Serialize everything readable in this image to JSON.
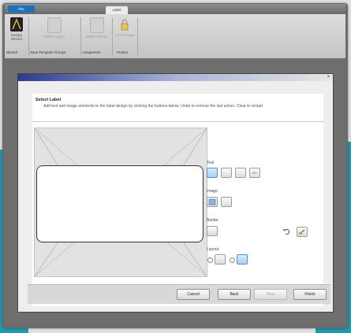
{
  "ribbon_tabs": [
    "File",
    "",
    "",
    "",
    "Label",
    ""
  ],
  "ribbon": {
    "buttons": [
      {
        "label": "Design Wizard",
        "icon": "wizard-icon"
      },
      {
        "label": "Batch Layout",
        "icon": "batch-layout-icon"
      },
      {
        "label": "Match Clause",
        "icon": "match-icon"
      },
      {
        "label": "Lock Groups",
        "icon": "lock-icon"
      }
    ],
    "groups": [
      "Wizard",
      "Save Template Groups",
      "Assignment",
      "Protect"
    ]
  },
  "dialog": {
    "section_title": "Select Label",
    "description": "Add text and image elements to the label design by clicking the buttons below. Undo to remove the last action. Clear to restart.",
    "text_label": "Text",
    "image_label": "Image",
    "border_label": "Border",
    "layout_label": "Layout",
    "text_buttons": [
      "",
      "",
      "",
      "A+"
    ],
    "close_glyph": "×"
  },
  "buttons": {
    "cancel": "Cancel",
    "back": "Back",
    "next": "Next",
    "finish": "Finish"
  },
  "colors": {
    "file_tab": "#1f6fbf",
    "dialog_title_start": "#2a3a90",
    "background_accent": "#1f9bb0"
  }
}
